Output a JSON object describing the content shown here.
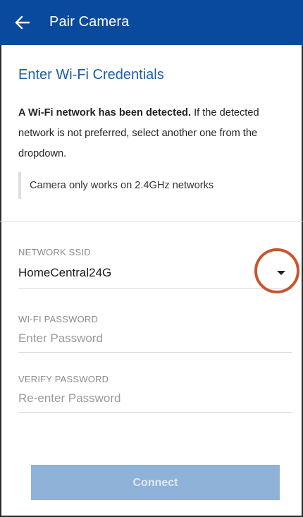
{
  "appbar": {
    "title": "Pair Camera",
    "back_icon": "arrow-left-icon",
    "color": "#0a4a9e"
  },
  "main": {
    "section_title": "Enter Wi-Fi Credentials",
    "description_bold": "A Wi-Fi network has been detected.",
    "description_rest": " If the detected network is not preferred, select another one from the dropdown.",
    "note": "Camera only works on 2.4GHz networks"
  },
  "form": {
    "ssid": {
      "label": "NETWORK SSID",
      "value": "HomeCentral24G",
      "dropdown_icon": "caret-down-icon"
    },
    "password": {
      "label": "WI-FI PASSWORD",
      "placeholder": "Enter Password",
      "value": ""
    },
    "verify": {
      "label": "VERIFY PASSWORD",
      "placeholder": "Re-enter Password",
      "value": ""
    }
  },
  "actions": {
    "connect_label": "Connect",
    "connect_color": "#8fb2d8"
  },
  "annotation": {
    "highlight_color": "#c8552e"
  }
}
